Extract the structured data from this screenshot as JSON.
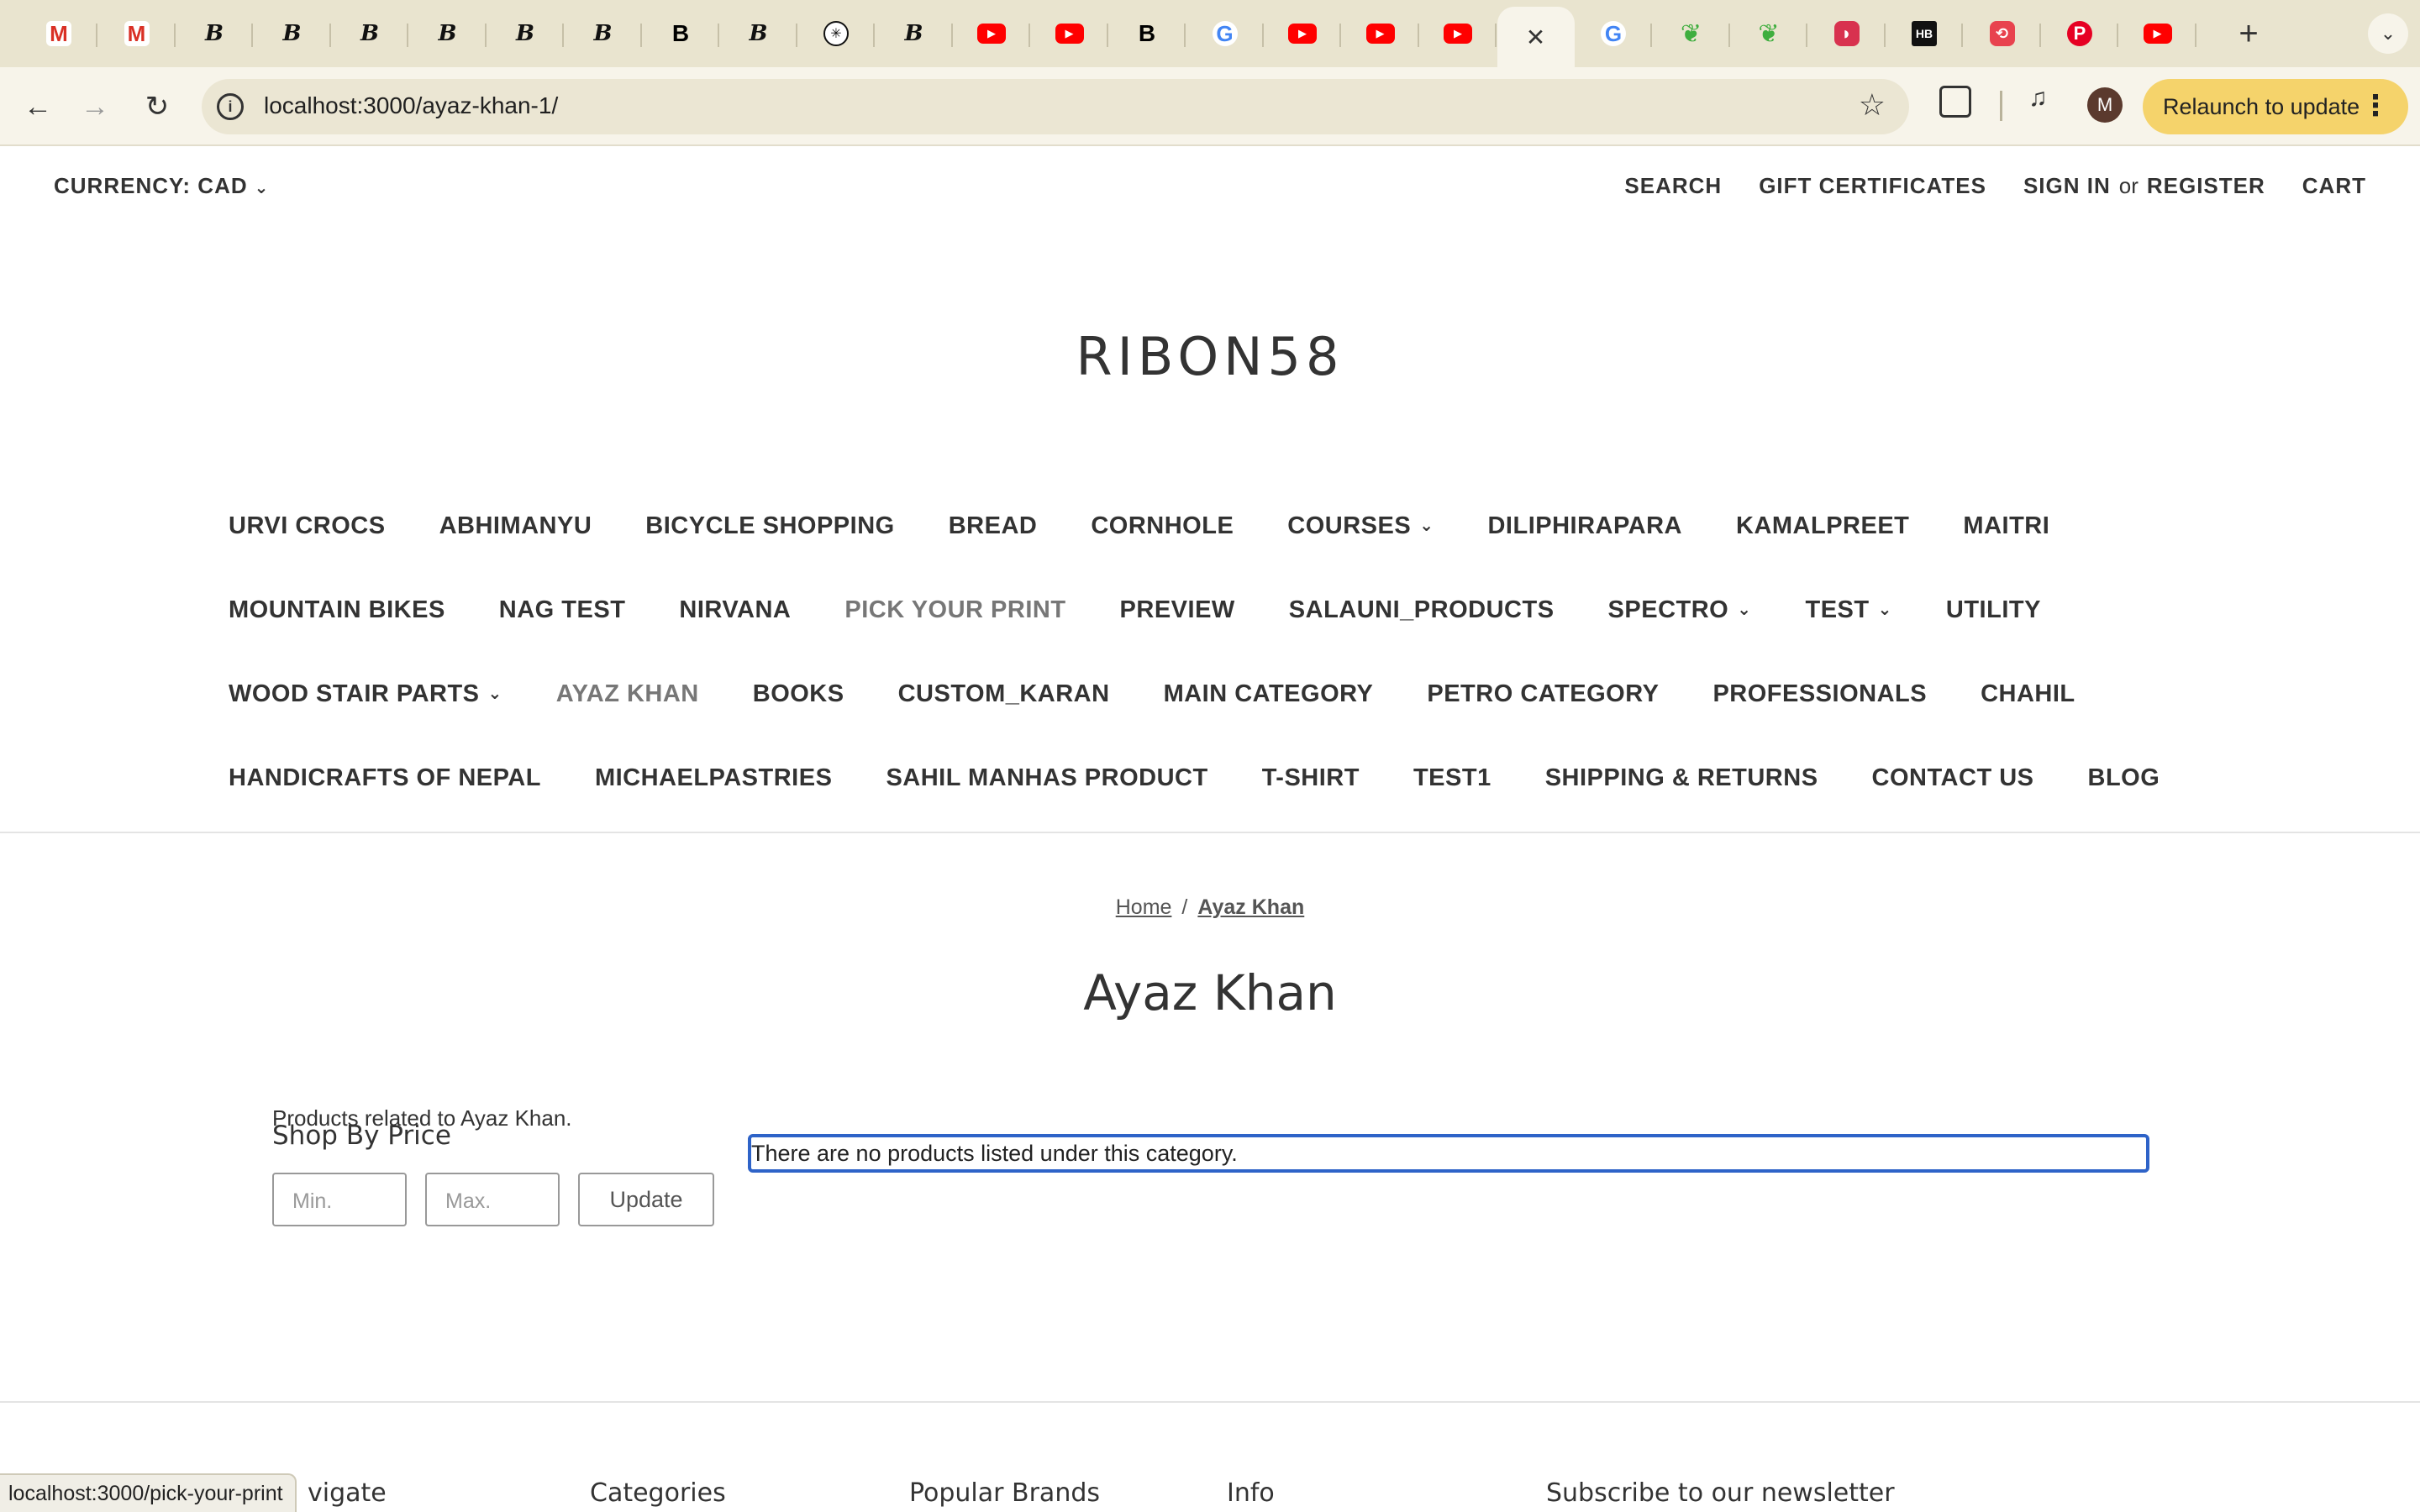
{
  "browser": {
    "tabs": [
      {
        "icon": "gmail-icon",
        "glyph": "M"
      },
      {
        "icon": "gmail-icon",
        "glyph": "M"
      },
      {
        "icon": "bigcommerce-icon",
        "glyph": "B"
      },
      {
        "icon": "bigcommerce-icon",
        "glyph": "B"
      },
      {
        "icon": "bigcommerce-icon",
        "glyph": "B"
      },
      {
        "icon": "bigcommerce-icon",
        "glyph": "B"
      },
      {
        "icon": "bigcommerce-icon",
        "glyph": "B"
      },
      {
        "icon": "bigcommerce-icon",
        "glyph": "B"
      },
      {
        "icon": "bigcommerce-dark-icon",
        "glyph": "B"
      },
      {
        "icon": "bigcommerce-icon",
        "glyph": "B"
      },
      {
        "icon": "chatgpt-icon",
        "glyph": "✳"
      },
      {
        "icon": "bigcommerce-icon",
        "glyph": "B"
      },
      {
        "icon": "youtube-icon",
        "glyph": "▶"
      },
      {
        "icon": "youtube-icon",
        "glyph": "▶"
      },
      {
        "icon": "bigcommerce-dark-icon",
        "glyph": "B"
      },
      {
        "icon": "google-icon",
        "glyph": "G"
      },
      {
        "icon": "youtube-icon",
        "glyph": "▶"
      },
      {
        "icon": "youtube-icon",
        "glyph": "▶"
      },
      {
        "icon": "youtube-icon",
        "glyph": "▶"
      },
      {
        "icon": "close-icon",
        "glyph": "✕",
        "active": true
      },
      {
        "icon": "google-icon",
        "glyph": "G"
      },
      {
        "icon": "leaf-icon",
        "glyph": "❦"
      },
      {
        "icon": "leaf-icon",
        "glyph": "❦"
      },
      {
        "icon": "red-app-icon",
        "glyph": "◗"
      },
      {
        "icon": "hb-icon",
        "glyph": "HB"
      },
      {
        "icon": "pdf-icon",
        "glyph": "⟲"
      },
      {
        "icon": "pinterest-icon",
        "glyph": "P"
      },
      {
        "icon": "youtube-icon",
        "glyph": "▶"
      }
    ],
    "new_tab_glyph": "+",
    "tab_search_glyph": "⌄",
    "back_glyph": "←",
    "forward_glyph": "→",
    "reload_glyph": "↻",
    "url": "localhost:3000/ayaz-khan-1/",
    "info_glyph": "i",
    "bookmark_glyph": "☆",
    "media_glyph": "♫",
    "profile_initial": "M",
    "relaunch_label": "Relaunch to update",
    "more_glyph": "⋮",
    "status_url": "localhost:3000/pick-your-print"
  },
  "store": {
    "currency_label": "CURRENCY: CAD",
    "chevron": "⌄",
    "util": {
      "search": "SEARCH",
      "gift": "GIFT CERTIFICATES",
      "signin": "SIGN IN",
      "or": "or",
      "register": "REGISTER",
      "cart": "CART"
    },
    "logo": "RIBON58",
    "nav_rows": [
      [
        {
          "label": "URVI CROCS"
        },
        {
          "label": "ABHIMANYU"
        },
        {
          "label": "BICYCLE SHOPPING"
        },
        {
          "label": "BREAD"
        },
        {
          "label": "CORNHOLE"
        },
        {
          "label": "COURSES",
          "dropdown": true
        },
        {
          "label": "DILIPHIRAPARA"
        },
        {
          "label": "KAMALPREET"
        },
        {
          "label": "MAITRI"
        }
      ],
      [
        {
          "label": "MOUNTAIN BIKES"
        },
        {
          "label": "NAG TEST"
        },
        {
          "label": "NIRVANA"
        },
        {
          "label": "PICK YOUR PRINT",
          "dim": true
        },
        {
          "label": "PREVIEW"
        },
        {
          "label": "SALAUNI_PRODUCTS"
        },
        {
          "label": "SPECTRO",
          "dropdown": true
        },
        {
          "label": "TEST",
          "dropdown": true
        },
        {
          "label": "UTILITY"
        }
      ],
      [
        {
          "label": "WOOD STAIR PARTS",
          "dropdown": true
        },
        {
          "label": "AYAZ KHAN",
          "dim": true
        },
        {
          "label": "BOOKS"
        },
        {
          "label": "CUSTOM_KARAN"
        },
        {
          "label": "MAIN CATEGORY"
        },
        {
          "label": "PETRO CATEGORY"
        },
        {
          "label": "PROFESSIONALS"
        },
        {
          "label": "CHAHIL"
        }
      ],
      [
        {
          "label": "HANDICRAFTS OF NEPAL"
        },
        {
          "label": "MICHAELPASTRIES"
        },
        {
          "label": "SAHIL MANHAS PRODUCT"
        },
        {
          "label": "T-SHIRT"
        },
        {
          "label": "TEST1"
        },
        {
          "label": "SHIPPING & RETURNS"
        },
        {
          "label": "CONTACT US"
        },
        {
          "label": "BLOG"
        }
      ]
    ],
    "breadcrumb": {
      "home": "Home",
      "separator": "/",
      "current": "Ayaz Khan"
    },
    "page_title": "Ayaz Khan",
    "category_description": "Products related to Ayaz Khan.",
    "shop_by_price": {
      "heading": "Shop By Price",
      "min_placeholder": "Min.",
      "max_placeholder": "Max.",
      "update_label": "Update"
    },
    "empty_message": "There are no products listed under this category.",
    "footer_headings": [
      "vigate",
      "Categories",
      "Popular Brands",
      "Info",
      "Subscribe to our newsletter"
    ]
  }
}
